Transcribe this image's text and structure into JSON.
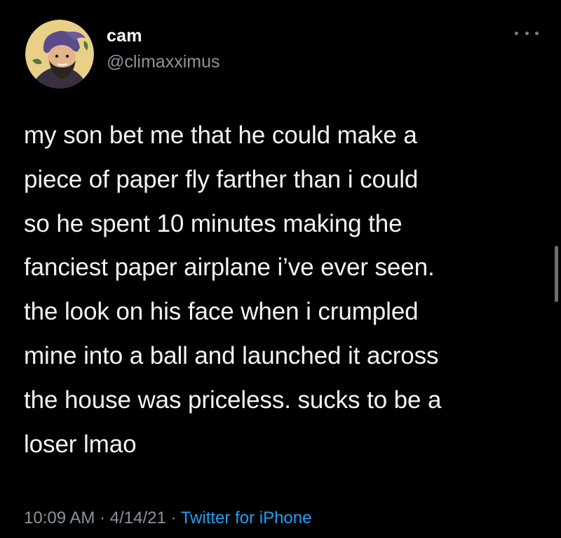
{
  "tweet": {
    "author": {
      "display_name": "cam",
      "handle": "@climaxximus",
      "avatar_icon": "cartoon-profile-avatar-icon"
    },
    "more_icon": "more-options-ellipsis-icon",
    "text": "my son bet me that he could make a\npiece of paper fly farther than i could\nso he spent 10 minutes making the\nfanciest paper airplane i’ve ever seen.\nthe look on his face when i crumpled\nmine into a ball and launched it across\nthe house was priceless. sucks to be a\nloser lmao",
    "time": "10:09 AM",
    "separator": " · ",
    "date": "4/14/21",
    "source": "Twitter for iPhone"
  },
  "colors": {
    "background": "#000000",
    "primary_text": "#f4f4f4",
    "secondary_text": "#8b949c",
    "link": "#1da1f2"
  }
}
